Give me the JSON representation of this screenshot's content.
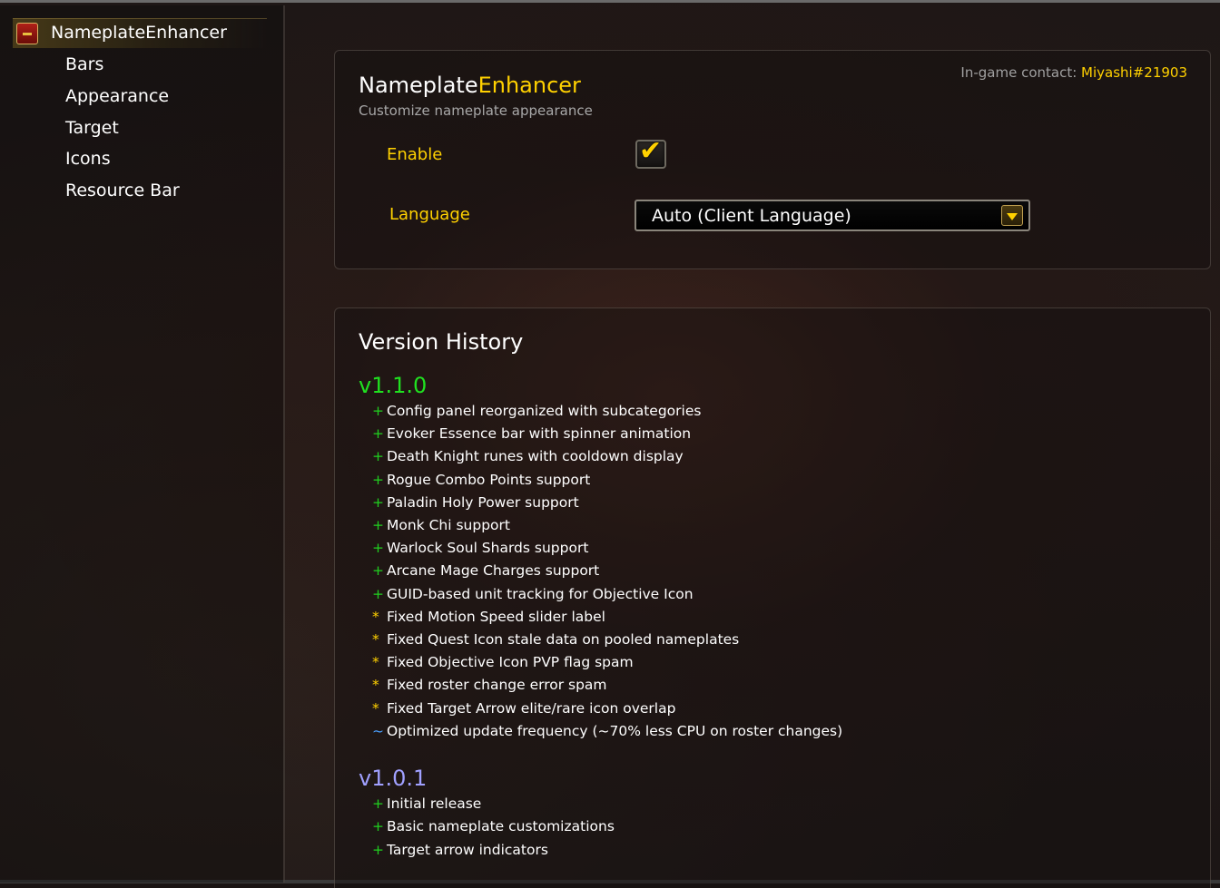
{
  "sidebar": {
    "title": "NameplateEnhancer",
    "items": [
      {
        "label": "Bars"
      },
      {
        "label": "Appearance"
      },
      {
        "label": "Target"
      },
      {
        "label": "Icons"
      },
      {
        "label": "Resource Bar"
      }
    ]
  },
  "header": {
    "title_part1": "Nameplate",
    "title_part2": "Enhancer",
    "subtitle": "Customize nameplate appearance",
    "contact_label": "In-game contact: ",
    "contact_value": "Miyashi#21903"
  },
  "settings": {
    "enable_label": "Enable",
    "enable_checked": true,
    "language_label": "Language",
    "language_value": "Auto (Client Language)"
  },
  "history": {
    "title": "Version History",
    "versions": [
      {
        "version": "v1.1.0",
        "entries": [
          {
            "marker": "+",
            "text": "Config panel reorganized with subcategories"
          },
          {
            "marker": "+",
            "text": "Evoker Essence bar with spinner animation"
          },
          {
            "marker": "+",
            "text": "Death Knight runes with cooldown display"
          },
          {
            "marker": "+",
            "text": "Rogue Combo Points support"
          },
          {
            "marker": "+",
            "text": "Paladin Holy Power support"
          },
          {
            "marker": "+",
            "text": "Monk Chi support"
          },
          {
            "marker": "+",
            "text": "Warlock Soul Shards support"
          },
          {
            "marker": "+",
            "text": "Arcane Mage Charges support"
          },
          {
            "marker": "+",
            "text": "GUID-based unit tracking for Objective Icon"
          },
          {
            "marker": "*",
            "text": "Fixed Motion Speed slider label"
          },
          {
            "marker": "*",
            "text": "Fixed Quest Icon stale data on pooled nameplates"
          },
          {
            "marker": "*",
            "text": "Fixed Objective Icon PVP flag spam"
          },
          {
            "marker": "*",
            "text": "Fixed roster change error spam"
          },
          {
            "marker": "*",
            "text": "Fixed Target Arrow elite/rare icon overlap"
          },
          {
            "marker": "~",
            "text": "Optimized update frequency (~70% less CPU on roster changes)"
          }
        ]
      },
      {
        "version": "v1.0.1",
        "entries": [
          {
            "marker": "+",
            "text": "Initial release"
          },
          {
            "marker": "+",
            "text": "Basic nameplate customizations"
          },
          {
            "marker": "+",
            "text": "Target arrow indicators"
          }
        ]
      }
    ]
  },
  "colors": {
    "accent_yellow": "#ffd100",
    "version_green": "#20e020",
    "version_blue": "#a0a0ff",
    "marker_plus": "#20d020",
    "marker_star": "#ffd100",
    "marker_tilde": "#4aa0ff"
  },
  "icons": {
    "addon": "addon-icon",
    "checkbox": "checkmark-icon",
    "dropdown": "chevron-down-icon"
  }
}
